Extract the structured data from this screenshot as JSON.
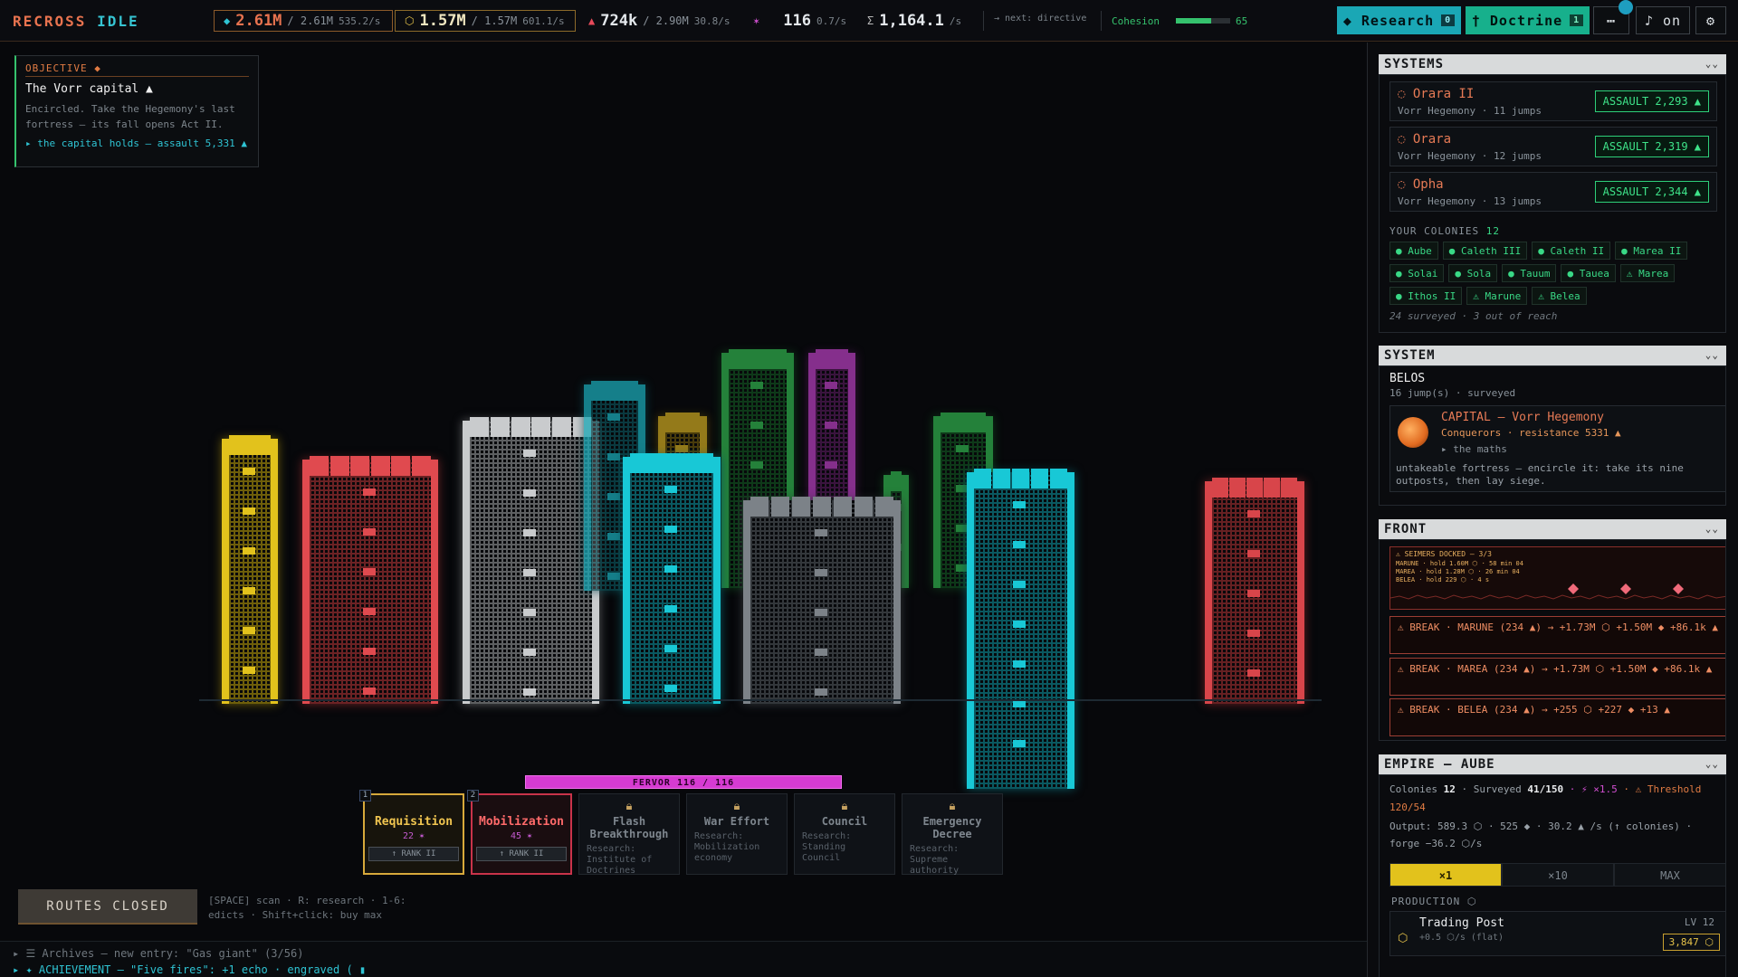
{
  "brand": {
    "part1": "RECROSS",
    "part2": "IDLE"
  },
  "resources": {
    "r1": {
      "icon": "◆",
      "value": "2.61M",
      "cap": "/ 2.61M",
      "rate": "535.2/s",
      "color": "#e8734f"
    },
    "r2": {
      "icon": "⬡",
      "value": "1.57M",
      "cap": "/ 1.57M",
      "rate": "601.1/s",
      "color": "#e6c34a"
    },
    "r3": {
      "icon": "▲",
      "value": "724k",
      "cap": "/ 2.90M",
      "rate": "30.8/s",
      "color": "#e84a5a"
    },
    "r4": {
      "icon": "✶",
      "value": "116",
      "rate": "0.7/s",
      "color": "#d04fd0"
    },
    "r5": {
      "icon": "Σ",
      "value": "1,164.1",
      "rate": "/s"
    },
    "next": "→ next: directive",
    "cohesion_label": "Cohesion",
    "cohesion_value": "65",
    "cohesion_pct": 0.65
  },
  "topbuttons": {
    "research": "◆ Research",
    "research_badge": "0",
    "doctrine": "† Doctrine",
    "doctrine_badge": "1",
    "more": "⋯",
    "music": "♪ on",
    "settings": "⚙"
  },
  "objective": {
    "tag": "OBJECTIVE ◆",
    "title": "The Vorr capital ▲",
    "desc": "Encircled. Take the Hegemony's last fortress — its fall opens Act II.",
    "hint": "▸ the capital holds — assault 5,331 ▲"
  },
  "fervor": "FERVOR 116 / 116",
  "abilities": [
    {
      "num": "1",
      "name": "Requisition",
      "cost": "22 ✶",
      "rank": "↑ RANK II"
    },
    {
      "num": "2",
      "name": "Mobilization",
      "cost": "45 ✶",
      "rank": "↑ RANK II"
    },
    {
      "name": "Flash Breakthrough",
      "req": "Research: Institute of Doctrines"
    },
    {
      "name": "War Effort",
      "req": "Research: Mobilization economy"
    },
    {
      "name": "Council",
      "req": "Research: Standing Council"
    },
    {
      "name": "Emergency Decree",
      "req": "Research: Supreme authority"
    }
  ],
  "routes": "ROUTES CLOSED",
  "keys": "[SPACE] scan · R: research · 1-6: edicts · Shift+click: buy max",
  "log": {
    "l1": "▸ ☰ Archives — new entry: \"Gas giant\" (3/56)",
    "l2": "▸ ✦ ACHIEVEMENT — \"Five fires\": +1 echo · engraved ( ▮"
  },
  "systems": {
    "header": "SYSTEMS",
    "rows": [
      {
        "name": "◌ Orara II",
        "sub": "Vorr Hegemony · 11 jumps",
        "action": "ASSAULT 2,293 ▲"
      },
      {
        "name": "◌ Orara",
        "sub": "Vorr Hegemony · 12 jumps",
        "action": "ASSAULT 2,319 ▲"
      },
      {
        "name": "◌ Opha",
        "sub": "Vorr Hegemony · 13 jumps",
        "action": "ASSAULT 2,344 ▲"
      }
    ],
    "colonies_label": "YOUR COLONIES",
    "colonies_count": "12",
    "colonies": [
      "● Aube",
      "● Caleth III",
      "● Caleth II",
      "● Marea II",
      "● Solai",
      "● Sola",
      "● Tauum",
      "● Tauea",
      "⚠ Marea",
      "● Ithos II",
      "⚠ Marune",
      "⚠ Belea"
    ],
    "footer": "24 surveyed · 3 out of reach"
  },
  "system": {
    "header": "SYSTEM",
    "name": "BELOS",
    "sub": "16 jump(s) · surveyed",
    "capital": "CAPITAL — Vorr Hegemony",
    "capital_sub": "Conquerors · resistance 5331 ▲",
    "maths": "▸ the maths",
    "desc": "untakeable fortress — encircle it: take its nine outposts, then lay siege."
  },
  "front": {
    "header": "FRONT",
    "mini_title": "⚠ SEIMERS DOCKED — 3/3",
    "mini_lines": [
      "MARUNE · hold 1.60M ⬡ · 58 min 04",
      "MAREA · hold 1.28M ⬡ · 26 min 04",
      "BELEA · hold 229 ⬡ · 4 s"
    ],
    "breaks": [
      "⚠ BREAK · MARUNE (234 ▲) → +1.73M ⬡ +1.50M ◆ +86.1k ▲",
      "⚠ BREAK · MAREA (234 ▲) → +1.73M ⬡ +1.50M ◆ +86.1k ▲",
      "⚠ BREAK · BELEA (234 ▲) → +255 ⬡ +227 ◆ +13 ▲"
    ]
  },
  "empire": {
    "header": "EMPIRE — AUBE",
    "line1_a": "Colonies",
    "line1_b": "12",
    "line1_c": "· Surveyed",
    "line1_d": "41/150",
    "line1_e": "· ⚡ ×1.5",
    "line1_f": "· ⚠ Threshold 120/54",
    "line2": "Output: 589.3 ⬡ · 525 ◆ · 30.2 ▲ /s (↑ colonies) · forge −36.2 ⬡/s",
    "tabs": [
      "×1",
      "×10",
      "MAX"
    ],
    "production": "PRODUCTION ⬡",
    "item_name": "Trading Post",
    "item_sub": "+0.5 ⬡/s (flat)",
    "item_level": "LV 12",
    "item_cost": "3,847 ⬡"
  }
}
